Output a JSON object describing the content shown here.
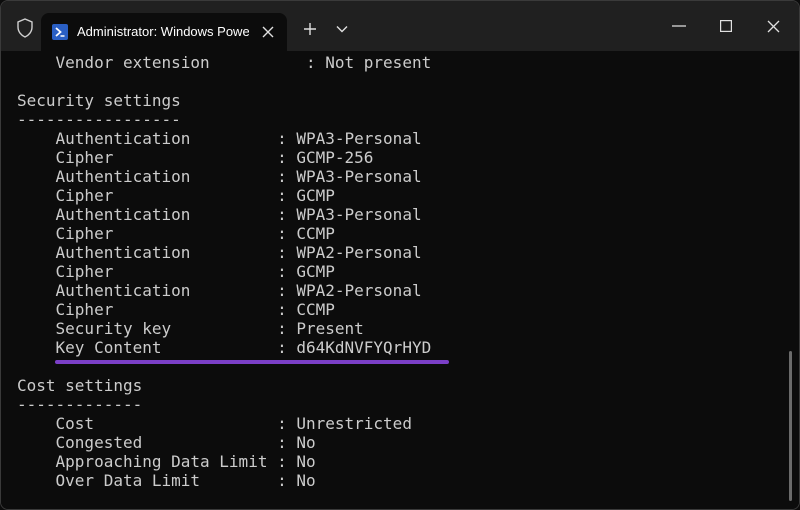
{
  "window": {
    "tab_title": "Administrator: Windows PowerShell",
    "icons": {
      "shield": "shield-icon",
      "powershell": "powershell-icon",
      "tab_close": "close-icon",
      "new_tab": "plus-icon",
      "dropdown": "chevron-down-icon",
      "minimize": "minimize-icon",
      "maximize": "maximize-icon",
      "close": "close-icon"
    },
    "colors": {
      "titlebar": "#202020",
      "terminal_bg": "#0c0c0c",
      "text": "#cccccc",
      "highlight": "#7b3fc7"
    }
  },
  "terminal": {
    "lines": [
      "    Vendor extension          : Not present",
      "",
      "Security settings",
      "-----------------",
      "    Authentication         : WPA3-Personal",
      "    Cipher                 : GCMP-256",
      "    Authentication         : WPA3-Personal",
      "    Cipher                 : GCMP",
      "    Authentication         : WPA3-Personal",
      "    Cipher                 : CCMP",
      "    Authentication         : WPA2-Personal",
      "    Cipher                 : GCMP",
      "    Authentication         : WPA2-Personal",
      "    Cipher                 : CCMP",
      "    Security key           : Present",
      "    Key Content            : d64KdNVFYQrHYD",
      "",
      "Cost settings",
      "-------------",
      "    Cost                   : Unrestricted",
      "    Congested              : No",
      "    Approaching Data Limit : No",
      "    Over Data Limit        : No"
    ]
  }
}
